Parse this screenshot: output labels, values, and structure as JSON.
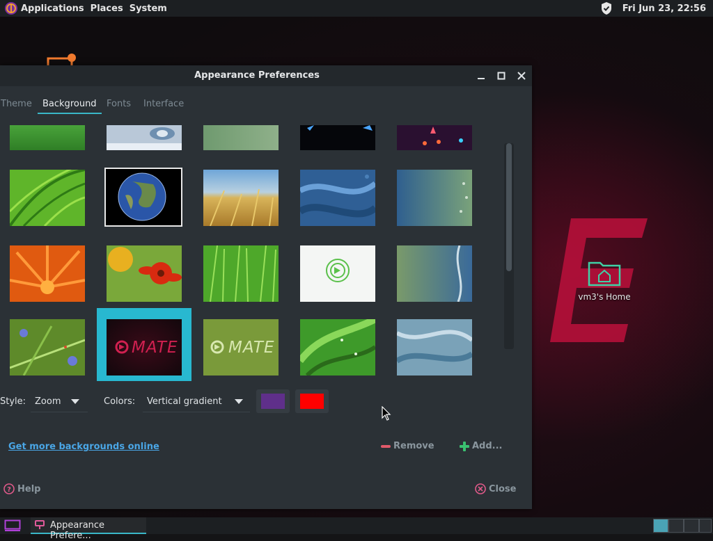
{
  "top_panel": {
    "menus": [
      "Applications",
      "Places",
      "System"
    ],
    "clock": "Fri Jun 23, 22:56"
  },
  "desktop": {
    "home_label": "vm3's Home"
  },
  "window": {
    "title": "Appearance Preferences",
    "tabs": [
      "Theme",
      "Background",
      "Fonts",
      "Interface"
    ],
    "active_tab": "Background",
    "thumbnails": [
      "green-gradient",
      "water-drop",
      "green-blur",
      "space-dark",
      "space-rocket",
      "green-leaf",
      "earth",
      "wheat-field",
      "blue-swirl",
      "teal-bubbles",
      "orange-flower",
      "red-flower",
      "grass",
      "mate-light-logo",
      "teal-wave",
      "bluebells",
      "mate-dark-logo",
      "mate-green-logo",
      "green-leaves",
      "blue-wave"
    ],
    "selected_thumbnail": "mate-dark-logo",
    "logo_text": "MATE",
    "style_label": "Style:",
    "style_value": "Zoom",
    "colors_label": "Colors:",
    "colors_value": "Vertical gradient",
    "primary_color": "#5f2f8a",
    "secondary_color": "#ff0000",
    "more_link": "Get more backgrounds online",
    "remove_label": "Remove",
    "add_label": "Add...",
    "help_label": "Help",
    "close_label": "Close"
  },
  "bottom_panel": {
    "task_label": "Appearance Prefere..."
  },
  "colors": {
    "accent": "#3ab7c8",
    "mate_red": "#c0103c"
  }
}
